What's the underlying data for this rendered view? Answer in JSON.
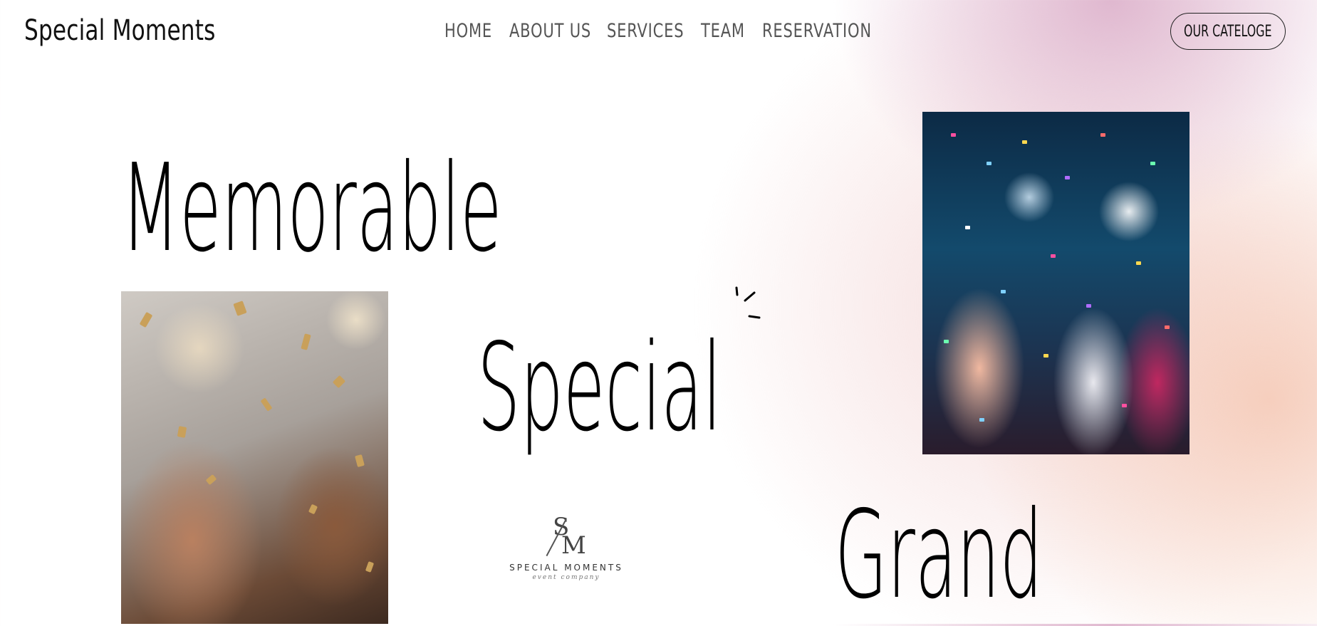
{
  "header": {
    "logo": "Special Moments",
    "nav": [
      {
        "label": "HOME"
      },
      {
        "label": "ABOUT US"
      },
      {
        "label": "SERVICES"
      },
      {
        "label": "TEAM"
      },
      {
        "label": "RESERVATION"
      }
    ],
    "cta_label": "OUR CATELOGE"
  },
  "hero": {
    "word1": "Memorable",
    "word2": "Special",
    "word3": "Grand"
  },
  "emblem": {
    "mark_s": "S",
    "mark_m": "M",
    "name": "SPECIAL MOMENTS",
    "tagline": "event company"
  },
  "icons": {
    "sparkle": "sparkle-icon"
  },
  "colors": {
    "text": "#000000",
    "nav_text": "#555555",
    "gradient_pink": "#deb4cd",
    "gradient_peach": "#f5c8b4"
  }
}
